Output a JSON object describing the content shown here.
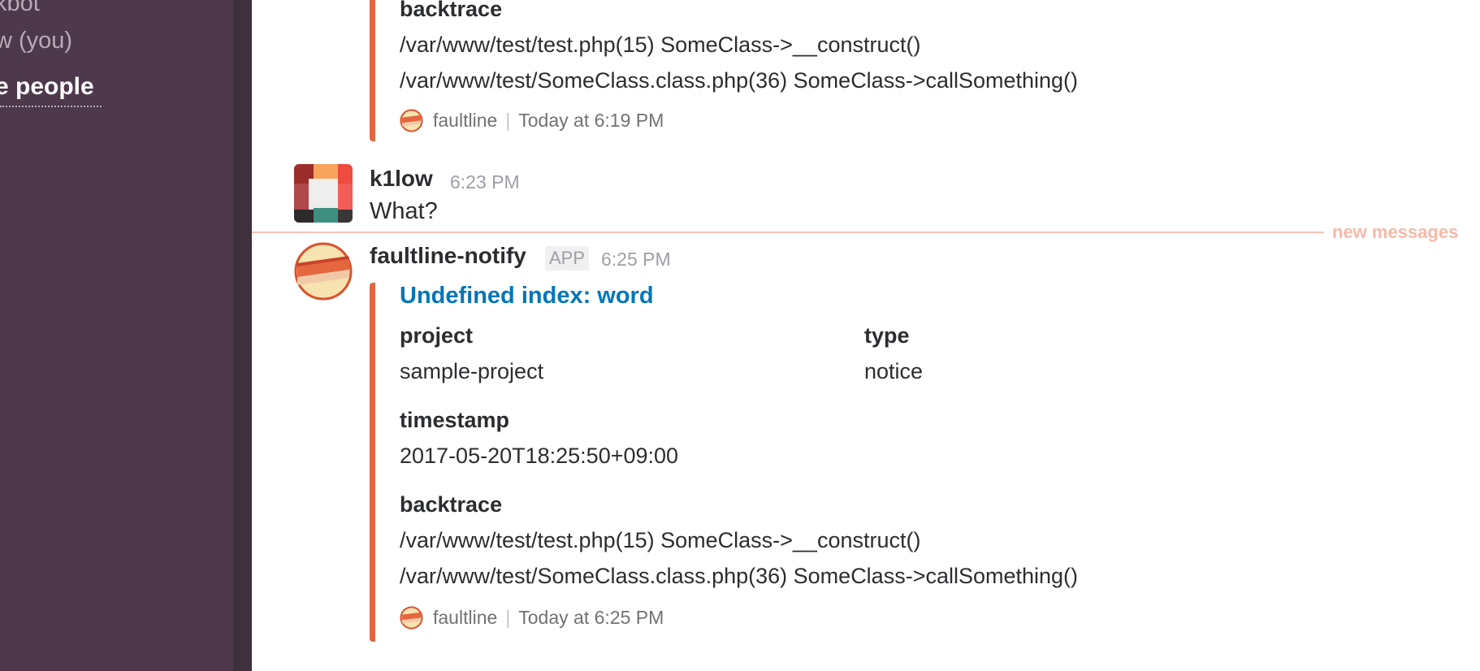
{
  "sidebar": {
    "items": [
      {
        "label": "kbot"
      },
      {
        "label": "w (you)"
      },
      {
        "label": "e people"
      }
    ]
  },
  "messages": {
    "prev_attachment": {
      "backtrace_title": "backtrace",
      "backtrace_lines": [
        "/var/www/test/test.php(15) SomeClass->__construct()",
        "/var/www/test/SomeClass.class.php(36) SomeClass->callSomething()"
      ],
      "footer_source": "faultline",
      "footer_time": "Today at 6:19 PM"
    },
    "k1low": {
      "name": "k1low",
      "time": "6:23 PM",
      "text": "What?"
    },
    "new_messages_label": "new messages",
    "notify": {
      "name": "faultline-notify",
      "badge": "APP",
      "time": "6:25 PM",
      "title": "Undefined index: word",
      "fields": {
        "project_title": "project",
        "project_value": "sample-project",
        "type_title": "type",
        "type_value": "notice",
        "timestamp_title": "timestamp",
        "timestamp_value": "2017-05-20T18:25:50+09:00",
        "backtrace_title": "backtrace"
      },
      "backtrace_lines": [
        "/var/www/test/test.php(15) SomeClass->__construct()",
        "/var/www/test/SomeClass.class.php(36) SomeClass->callSomething()"
      ],
      "footer_source": "faultline",
      "footer_time": "Today at 6:25 PM"
    }
  },
  "colors": {
    "sidebar": "#4d394b",
    "attachment_bar": "#e5673f",
    "link": "#0576b9",
    "new_messages": "#f7b9a8"
  }
}
